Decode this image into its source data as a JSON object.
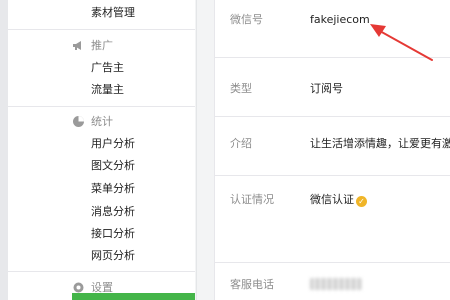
{
  "sidebar": {
    "top_item": "素材管理",
    "groups": [
      {
        "label": "推广",
        "icon": "megaphone-icon",
        "items": [
          "广告主",
          "流量主"
        ]
      },
      {
        "label": "统计",
        "icon": "pie-chart-icon",
        "items": [
          "用户分析",
          "图文分析",
          "菜单分析",
          "消息分析",
          "接口分析",
          "网页分析"
        ]
      },
      {
        "label": "设置",
        "icon": "gear-icon",
        "items": []
      }
    ]
  },
  "info": {
    "rows": [
      {
        "label": "微信号",
        "value": "fakejiecom"
      },
      {
        "label": "类型",
        "value": "订阅号"
      },
      {
        "label": "介绍",
        "value": "让生活增添情趣，让爱更有激情..."
      },
      {
        "label": "认证情况",
        "value": "微信认证"
      },
      {
        "label": "客服电话",
        "value": ""
      }
    ]
  },
  "colors": {
    "accent_green": "#44b549",
    "annotation_arrow": "#e53935",
    "verified_badge": "#f0b528"
  }
}
